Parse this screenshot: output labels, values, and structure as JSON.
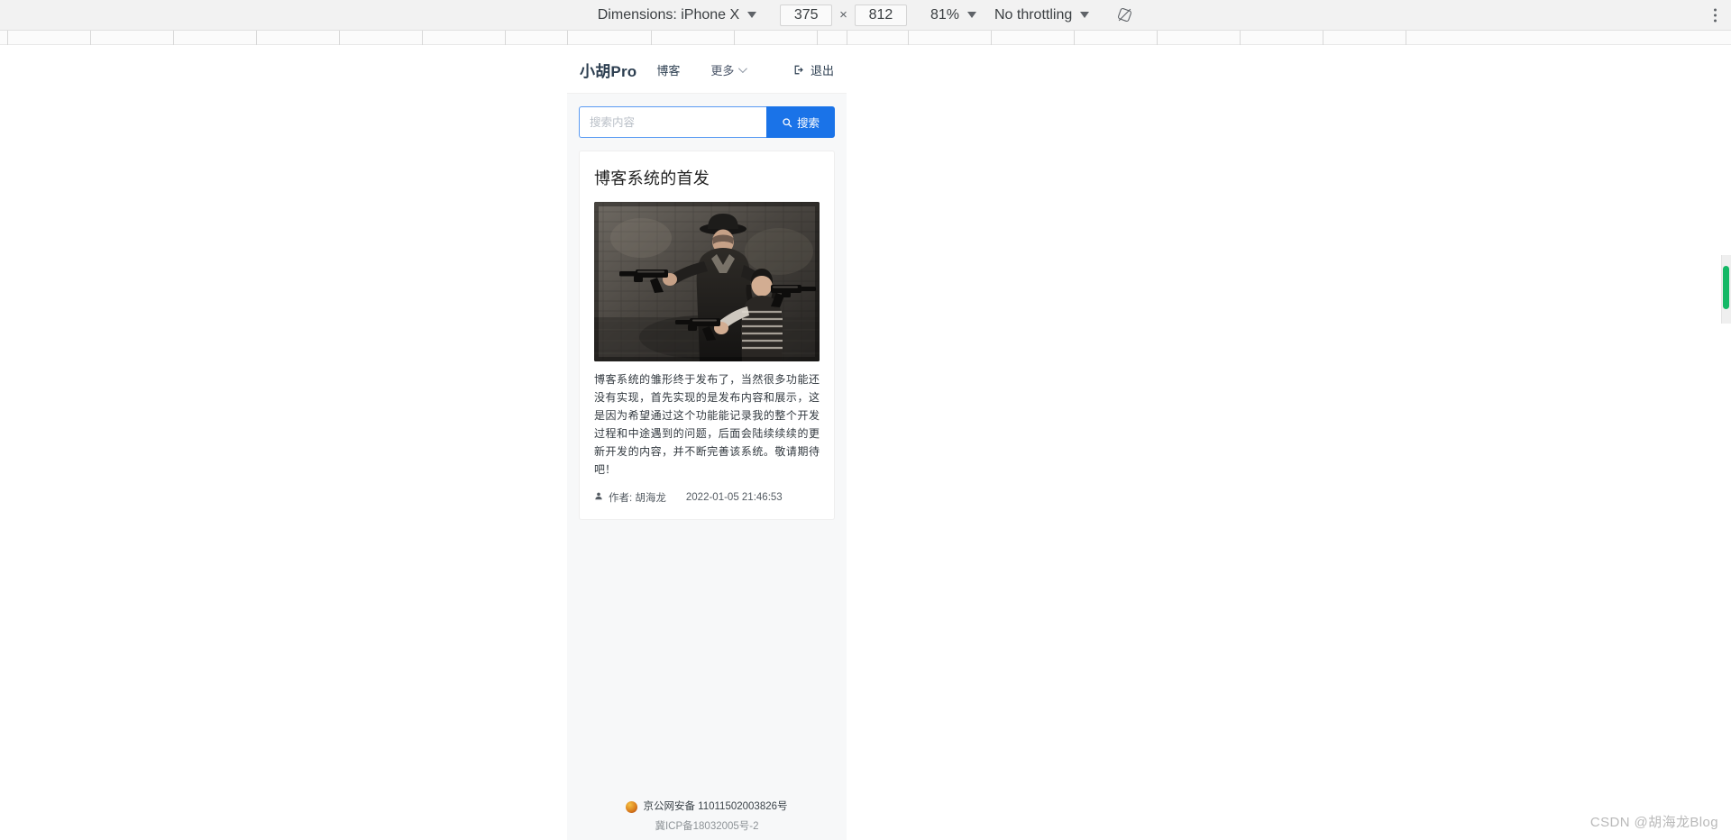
{
  "devtools": {
    "dimensions_label": "Dimensions: iPhone X",
    "width_value": "375",
    "times": "×",
    "height_value": "812",
    "zoom_level": "81%",
    "throttling": "No throttling",
    "rotate_icon": "rotate-icon",
    "menu_icon": "more-vertical-icon"
  },
  "site": {
    "brand": "小胡Pro",
    "nav_blog": "博客",
    "nav_more": "更多",
    "logout": "退出",
    "search_placeholder": "搜索内容",
    "search_value": "",
    "search_button": "搜索"
  },
  "article": {
    "title": "博客系统的首发",
    "body": "博客系统的雏形终于发布了，当然很多功能还没有实现，首先实现的是发布内容和展示，这是因为希望通过这个功能能记录我的整个开发过程和中途遇到的问题，后面会陆续续续的更新开发的内容，并不断完善该系统。敬请期待吧！",
    "author_label": "作者: 胡海龙",
    "date": "2022-01-05 21:46:53"
  },
  "footer": {
    "beian_police": "京公网安备 11011502003826号",
    "beian_icp": "冀ICP备18032005号-2"
  },
  "watermark": "CSDN @胡海龙Blog",
  "colors": {
    "accent": "#1a73e8",
    "input_focus_border": "#5b9bf3",
    "brand_text": "#2c3e50",
    "stage_bg": "#f7f8f9",
    "scrollbar": "#14b866"
  }
}
